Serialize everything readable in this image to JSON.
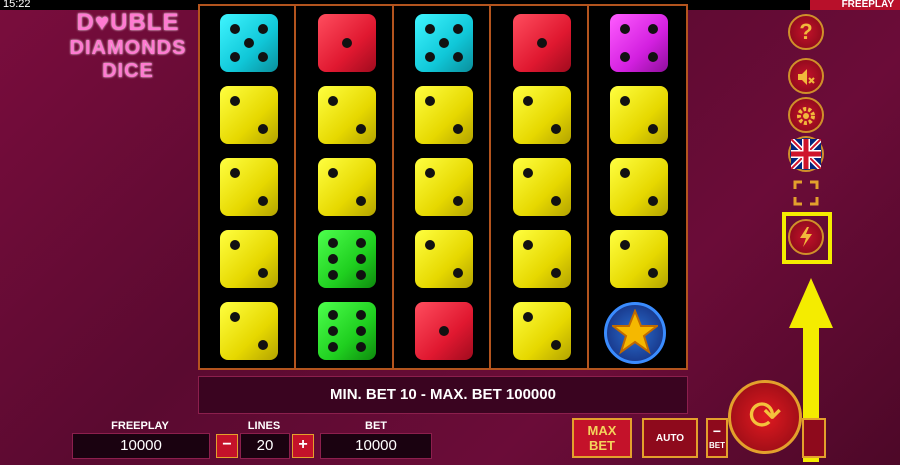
{
  "status_bar": {
    "time": "15:22",
    "mode": "FREEPLAY"
  },
  "logo": {
    "line1": "D♥UBLE",
    "line2": "DIAMONDS",
    "line3": "DICE"
  },
  "reels": [
    [
      "cyan-5",
      "yellow-2",
      "yellow-2",
      "yellow-2",
      "yellow-2"
    ],
    [
      "red-1",
      "yellow-2",
      "yellow-2",
      "green-6",
      "green-6"
    ],
    [
      "cyan-5",
      "yellow-2",
      "yellow-2",
      "yellow-2",
      "red-1"
    ],
    [
      "red-1",
      "yellow-2",
      "yellow-2",
      "yellow-2",
      "yellow-2"
    ],
    [
      "magenta-4",
      "yellow-2",
      "yellow-2",
      "yellow-2",
      "star-scatter"
    ]
  ],
  "message": "MIN. BET 10 - MAX. BET 100000",
  "side_menu": {
    "help_label": "?",
    "icons": [
      "help-icon",
      "sound-muted-icon",
      "settings-gear-icon",
      "language-uk-flag-icon",
      "fullscreen-icon",
      "turbo-lightning-icon"
    ]
  },
  "bottom": {
    "freeplay_label": "FREEPLAY",
    "freeplay_value": "10000",
    "lines_label": "LINES",
    "lines_value": "20",
    "lines_minus": "−",
    "lines_plus": "+",
    "bet_label": "BET",
    "bet_value": "10000",
    "maxbet_line1": "MAX",
    "maxbet_line2": "BET",
    "auto_label": "AUTO",
    "bet_minus": "−",
    "bet_minus_caption": "BET",
    "spin_symbol": "⟳"
  },
  "colors": {
    "accent": "#e3a02c",
    "annotation": "#f4ec00",
    "background": "#6b0c38"
  }
}
